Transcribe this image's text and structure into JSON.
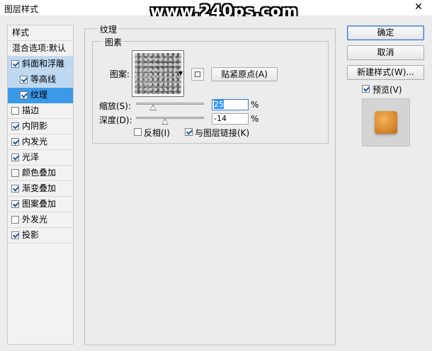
{
  "window": {
    "title": "图层样式",
    "close_glyph": "✕"
  },
  "watermark": "www.240ps.com",
  "styles_list": [
    {
      "label": "样式",
      "type": "header"
    },
    {
      "label": "混合选项:默认",
      "type": "header"
    },
    {
      "label": "斜面和浮雕",
      "checked": true,
      "state": "selected-light"
    },
    {
      "label": "等高线",
      "checked": true,
      "state": "sub"
    },
    {
      "label": "纹理",
      "checked": true,
      "state": "sub-selected"
    },
    {
      "label": "描边",
      "checked": false
    },
    {
      "label": "内阴影",
      "checked": true
    },
    {
      "label": "内发光",
      "checked": true
    },
    {
      "label": "光泽",
      "checked": true
    },
    {
      "label": "颜色叠加",
      "checked": false
    },
    {
      "label": "渐变叠加",
      "checked": true
    },
    {
      "label": "图案叠加",
      "checked": true
    },
    {
      "label": "外发光",
      "checked": false
    },
    {
      "label": "投影",
      "checked": true
    }
  ],
  "texture": {
    "group_title": "纹理",
    "elements_title": "图素",
    "pattern_label": "图案:",
    "snap_button": "贴紧原点(A)",
    "scale_label": "缩放(S):",
    "scale_value": "25",
    "scale_pct": 25,
    "depth_label": "深度(D):",
    "depth_value": "-14",
    "depth_pct": 43,
    "percent": "%",
    "invert_label": "反相(I)",
    "invert_checked": false,
    "link_label": "与图层链接(K)",
    "link_checked": true
  },
  "actions": {
    "ok": "确定",
    "cancel": "取消",
    "new_style": "新建样式(W)...",
    "preview_label": "预览(V)",
    "preview_checked": true
  },
  "colors": {
    "accent": "#3b9ae8",
    "preview": "#e09a40"
  }
}
